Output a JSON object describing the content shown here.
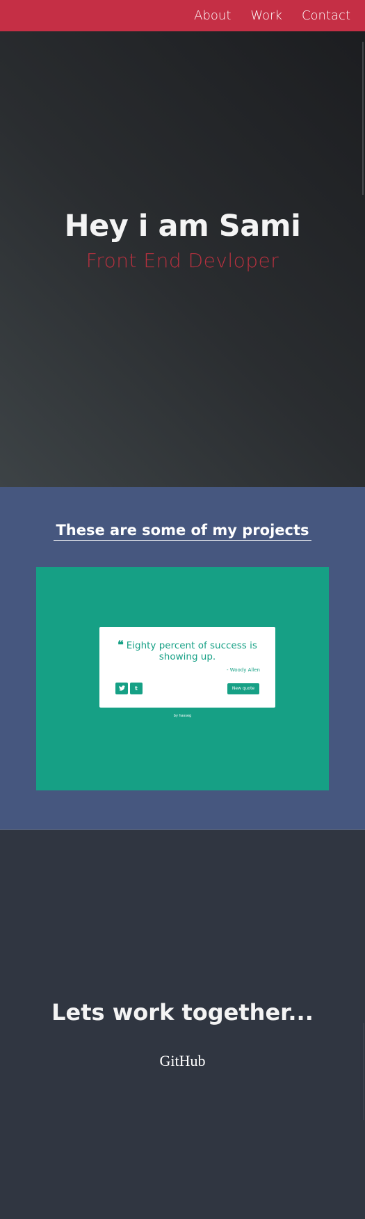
{
  "nav": {
    "links": [
      "About",
      "Work",
      "Contact"
    ]
  },
  "hero": {
    "title": "Hey i am Sami",
    "subtitle": "Front End Devloper"
  },
  "projects": {
    "heading": "These are some of my projects",
    "card": {
      "quote": "Eighty percent of success is showing up.",
      "author": "- Woody Allen",
      "new_quote_label": "New quote",
      "footer": "by hasseg",
      "share_icons": [
        "twitter-icon",
        "tumblr-icon"
      ]
    }
  },
  "contact": {
    "title": "Lets work together...",
    "github_label": "GitHub"
  },
  "colors": {
    "nav_bg": "#c52f45",
    "accent_red": "#b9313f",
    "projects_bg": "#46577f",
    "card_green": "#16a085",
    "contact_bg": "#303641"
  }
}
